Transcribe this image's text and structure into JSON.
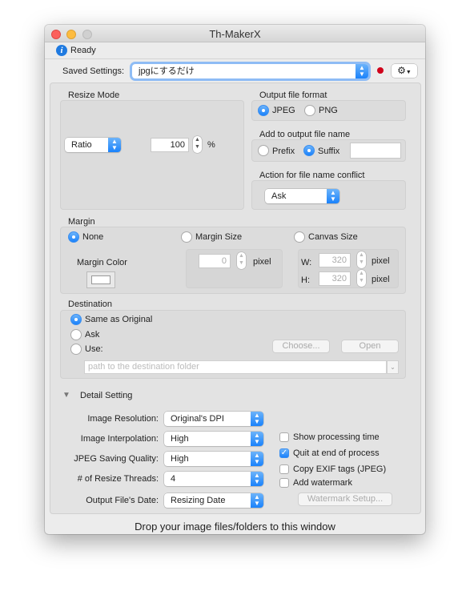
{
  "window": {
    "title": "Th-MakerX",
    "status": "Ready"
  },
  "saved_settings": {
    "label": "Saved Settings:",
    "value": "jpgにするだけ",
    "indicator_color": "#d0021b"
  },
  "resize_mode": {
    "label": "Resize Mode",
    "mode": "Ratio",
    "value": "100",
    "unit": "%"
  },
  "output_format": {
    "label": "Output file format",
    "options": [
      "JPEG",
      "PNG"
    ],
    "selected": "JPEG"
  },
  "add_name": {
    "label": "Add to output file name",
    "options": [
      "Prefix",
      "Suffix"
    ],
    "selected": "Suffix",
    "value": ""
  },
  "conflict": {
    "label": "Action for file name conflict",
    "value": "Ask"
  },
  "margin": {
    "label": "Margin",
    "options": [
      "None",
      "Margin Size",
      "Canvas Size"
    ],
    "selected": "None",
    "color_label": "Margin Color",
    "margin_value": "0",
    "unit": "pixel",
    "w_label": "W:",
    "h_label": "H:",
    "width": "320",
    "height": "320"
  },
  "destination": {
    "label": "Destination",
    "options": [
      "Same as Original",
      "Ask",
      "Use:"
    ],
    "selected": "Same as Original",
    "choose": "Choose...",
    "open": "Open",
    "path_placeholder": "path to the destination folder"
  },
  "detail": {
    "label": "Detail Setting",
    "rows": [
      {
        "label": "Image Resolution:",
        "value": "Original's DPI"
      },
      {
        "label": "Image Interpolation:",
        "value": "High"
      },
      {
        "label": "JPEG Saving Quality:",
        "value": "High"
      },
      {
        "label": "# of Resize Threads:",
        "value": "4"
      },
      {
        "label": "Output File's Date:",
        "value": "Resizing Date"
      }
    ],
    "checks": [
      {
        "label": "Show processing time",
        "checked": false
      },
      {
        "label": "Quit at end of process",
        "checked": true
      },
      {
        "label": "Copy EXIF tags (JPEG)",
        "checked": false
      },
      {
        "label": "Add watermark",
        "checked": false
      }
    ],
    "watermark_button": "Watermark Setup..."
  },
  "footer": "Drop your image files/folders to this window",
  "colors": {
    "accent": "#1a82fb"
  }
}
